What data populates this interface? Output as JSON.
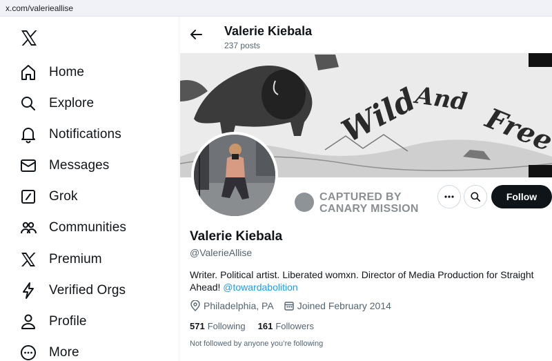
{
  "browser": {
    "url": "x.com/valerieallise"
  },
  "sidebar": {
    "logo_icon": "x-logo-icon",
    "items": [
      {
        "label": "Home",
        "icon": "home-icon"
      },
      {
        "label": "Explore",
        "icon": "search-icon"
      },
      {
        "label": "Notifications",
        "icon": "bell-icon"
      },
      {
        "label": "Messages",
        "icon": "envelope-icon"
      },
      {
        "label": "Grok",
        "icon": "grok-icon"
      },
      {
        "label": "Communities",
        "icon": "people-icon"
      },
      {
        "label": "Premium",
        "icon": "x-logo-icon"
      },
      {
        "label": "Verified Orgs",
        "icon": "lightning-icon"
      },
      {
        "label": "Profile",
        "icon": "person-icon"
      },
      {
        "label": "More",
        "icon": "more-circle-icon"
      }
    ]
  },
  "header": {
    "name": "Valerie Kiebala",
    "posts": "237 posts"
  },
  "banner": {
    "artwork_text": "Wild And Free"
  },
  "stamp": {
    "line1": "CAPTURED BY",
    "line2": "CANARY MISSION"
  },
  "actions": {
    "follow_label": "Follow"
  },
  "profile": {
    "name": "Valerie Kiebala",
    "handle": "@ValerieAllise",
    "bio_text": "Writer. Political artist. Liberated womxn. Director of Media Production for Straight Ahead!",
    "bio_mention": "@towardabolition",
    "location": "Philadelphia, PA",
    "joined": "Joined February 2014",
    "following_count": "571",
    "following_label": "Following",
    "followers_count": "161",
    "followers_label": "Followers",
    "not_followed_note": "Not followed by anyone you’re following"
  },
  "colors": {
    "accent": "#1d9bf0",
    "text": "#0f1419",
    "muted": "#536471",
    "follow_bg": "#0f1419"
  }
}
